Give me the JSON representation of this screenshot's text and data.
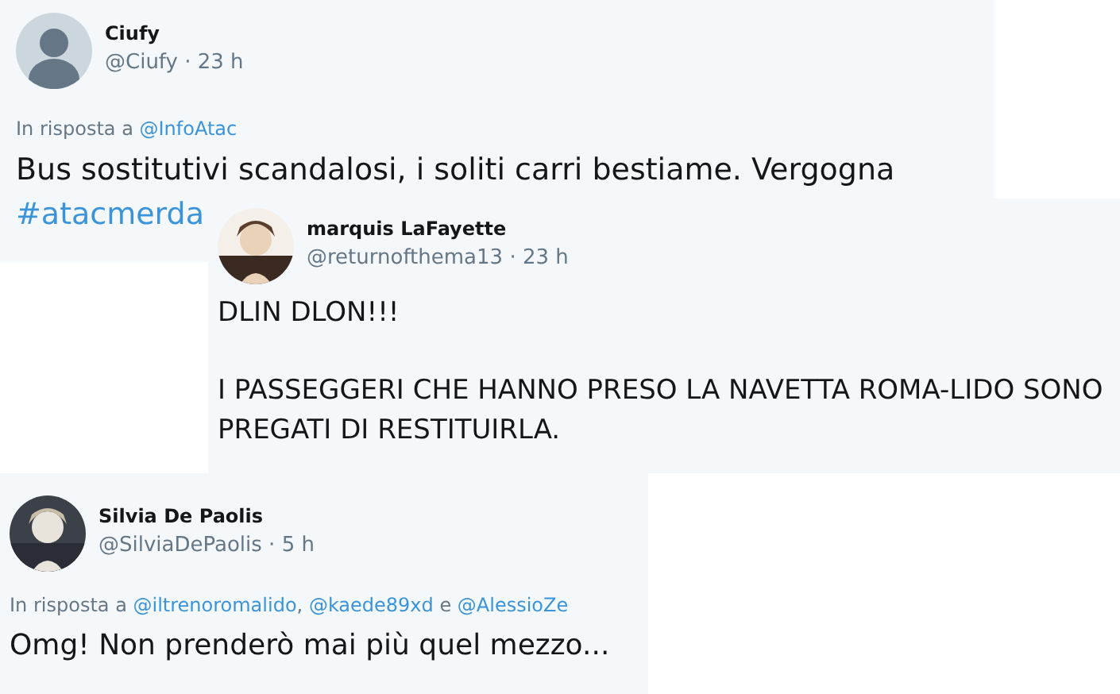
{
  "tweets": [
    {
      "name": "Ciufy",
      "handle": "@Ciufy",
      "separator": "·",
      "time": "23 h",
      "avatar": {
        "kind": "default"
      },
      "reply": {
        "label": "In risposta a",
        "parts": [
          {
            "kind": "link",
            "text": "@InfoAtac"
          }
        ]
      },
      "body": [
        [
          {
            "kind": "text",
            "text": "Bus sostitutivi scandalosi, i soliti carri bestiame. Vergogna "
          },
          {
            "kind": "link",
            "text": "#atacmerda"
          }
        ]
      ]
    },
    {
      "name": "marquis LaFayette",
      "handle": "@returnofthema13",
      "separator": "·",
      "time": "23 h",
      "avatar": {
        "kind": "picture"
      },
      "body": [
        [
          {
            "kind": "text",
            "text": "DLIN DLON!!!"
          }
        ],
        [
          {
            "kind": "text",
            "text": "I PASSEGGERI CHE HANNO PRESO LA NAVETTA ROMA-LIDO SONO PREGATI DI RESTITUIRLA."
          }
        ]
      ]
    },
    {
      "name": "Silvia De Paolis",
      "handle": "@SilviaDePaolis",
      "separator": "·",
      "time": "5 h",
      "avatar": {
        "kind": "picture"
      },
      "reply": {
        "label": "In risposta a",
        "parts": [
          {
            "kind": "link",
            "text": "@iltrenoromalido"
          },
          {
            "kind": "text",
            "text": ", "
          },
          {
            "kind": "link",
            "text": "@kaede89xd"
          },
          {
            "kind": "text",
            "text": " e "
          },
          {
            "kind": "link",
            "text": "@AlessioZe"
          }
        ]
      },
      "body": [
        [
          {
            "kind": "text",
            "text": "Omg! Non prenderò mai più quel mezzo..."
          }
        ]
      ]
    }
  ]
}
